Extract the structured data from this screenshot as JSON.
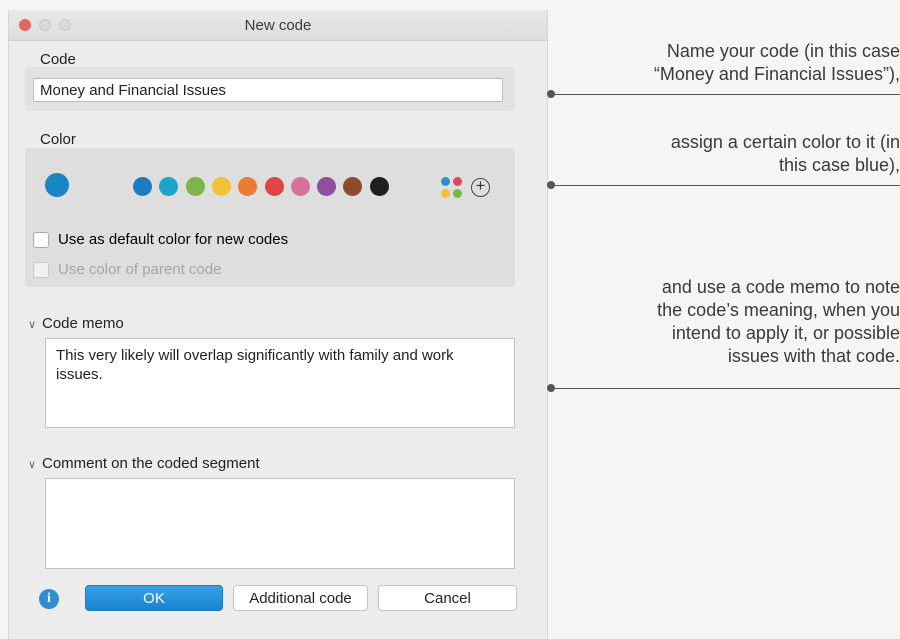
{
  "window": {
    "title": "New code"
  },
  "code": {
    "label": "Code",
    "value": "Money and Financial Issues"
  },
  "color": {
    "label": "Color",
    "selected": "#1b84c4",
    "swatches": [
      "#1b7ec2",
      "#1aa6c9",
      "#7db54b",
      "#f1c13b",
      "#ec7a36",
      "#e14444",
      "#d9719d",
      "#8e4fa0",
      "#8f4a2d",
      "#1f1f1f"
    ],
    "palette_icon": "palette-icon",
    "add_icon": "plus-circle-icon",
    "default_checkbox_label": "Use as default color for new codes",
    "parent_checkbox_label": "Use color of parent code"
  },
  "memo": {
    "label": "Code memo",
    "text": "This very likely will overlap significantly with family and work issues."
  },
  "comment": {
    "label": "Comment on the coded segment",
    "text": ""
  },
  "buttons": {
    "ok": "OK",
    "additional": "Additional code",
    "cancel": "Cancel"
  },
  "annotations": [
    {
      "lines": [
        "Name your code (in this case",
        "“Money and Financial Issues”),"
      ]
    },
    {
      "lines": [
        "assign a certain color to it (in",
        "this case blue),"
      ]
    },
    {
      "lines": [
        "and use a code memo to note",
        "the code’s meaning, when you",
        "intend to apply it, or possible",
        "issues with that code."
      ]
    }
  ],
  "colors": {
    "accent": "#1684d0",
    "dialog_bg": "#ececec"
  }
}
